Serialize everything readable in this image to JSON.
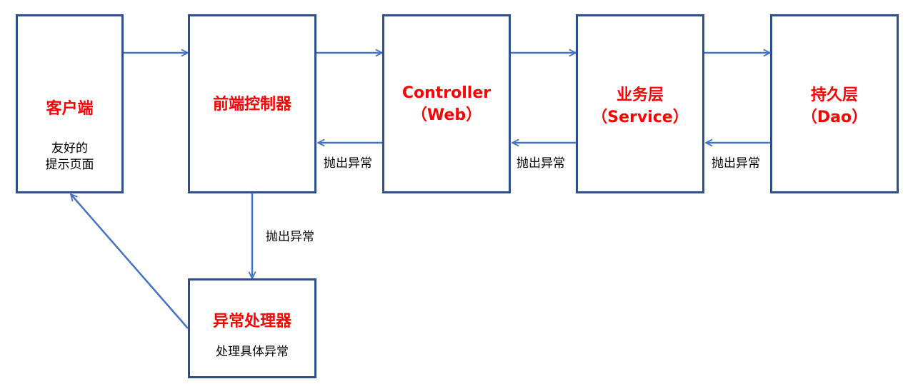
{
  "diagram": {
    "nodes": {
      "client": {
        "title": "客户端",
        "desc_line1": "友好的",
        "desc_line2": "提示页面"
      },
      "front_controller": {
        "title": "前端控制器"
      },
      "controller": {
        "title_line1": "Controller",
        "title_line2": "（Web）"
      },
      "service": {
        "title_line1": "业务层",
        "title_line2": "（Service）"
      },
      "persistence": {
        "title_line1": "持久层",
        "title_line2": "（Dao）"
      },
      "exception_handler": {
        "title": "异常处理器",
        "desc": "处理具体异常"
      }
    },
    "edge_labels": {
      "controller_to_front": "抛出异常",
      "service_to_controller": "抛出异常",
      "persistence_to_service": "抛出异常",
      "front_to_handler": "抛出异常"
    },
    "colors": {
      "border": "#2e4f8c",
      "arrow": "#4472c4",
      "title": "#ff0000",
      "text": "#000000"
    }
  }
}
